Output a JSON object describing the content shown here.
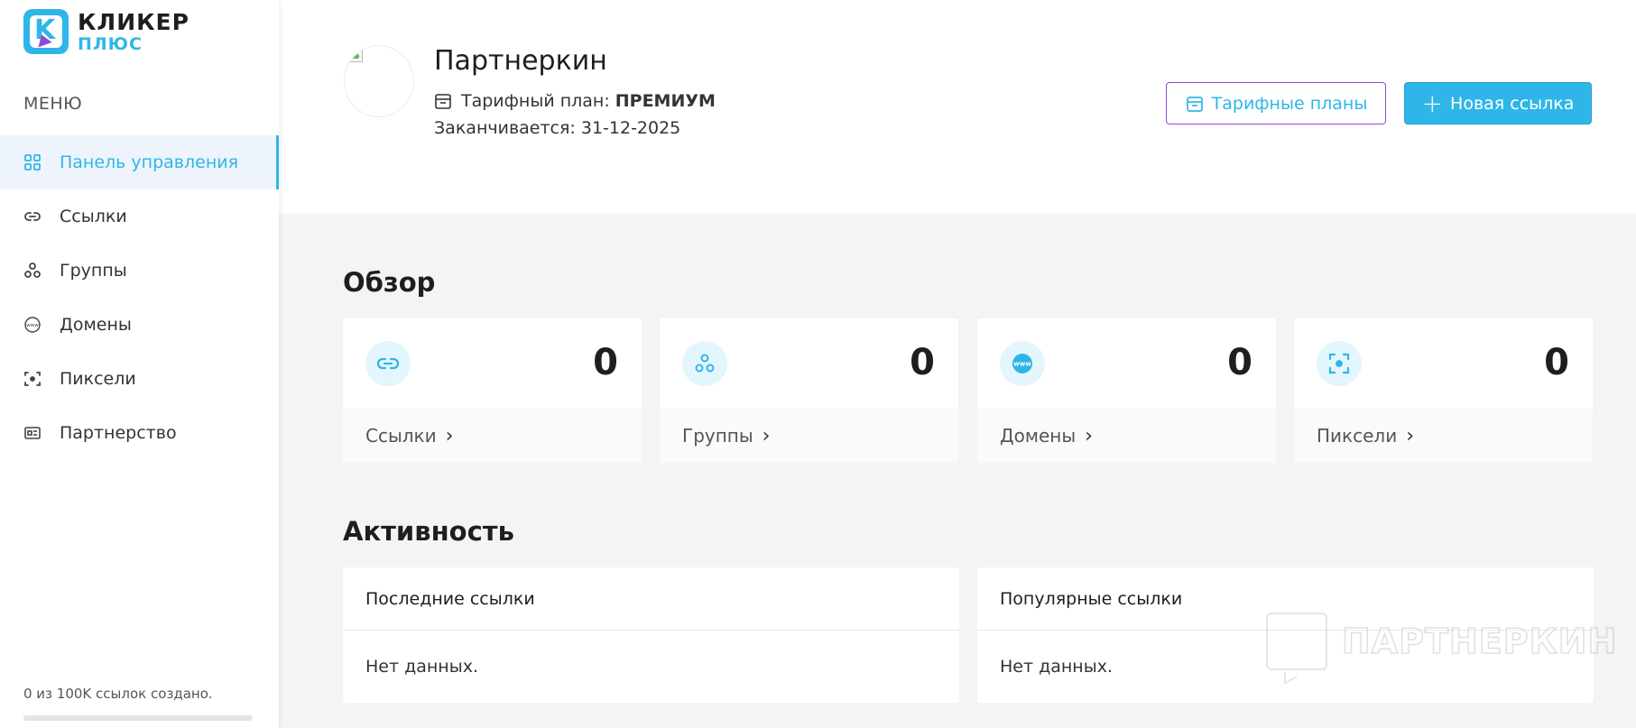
{
  "brand": {
    "name_line1": "КЛИКЕР",
    "name_line2": "ПЛЮС",
    "logo_letter": "K",
    "accent_color": "#2fb6e8",
    "secondary_color": "#8a4bd6"
  },
  "sidebar": {
    "menu_title": "МЕНЮ",
    "items": [
      {
        "label": "Панель управления",
        "icon": "dashboard-icon",
        "active": true
      },
      {
        "label": "Ссылки",
        "icon": "link-icon"
      },
      {
        "label": "Группы",
        "icon": "groups-icon"
      },
      {
        "label": "Домены",
        "icon": "domain-icon"
      },
      {
        "label": "Пиксели",
        "icon": "pixel-icon"
      },
      {
        "label": "Партнерство",
        "icon": "partnership-icon"
      }
    ],
    "usage_text": "0 из 100K ссылок создано.",
    "usage_fraction": 0
  },
  "header": {
    "username": "Партнеркин",
    "plan_label": "Тарифный план:",
    "plan_value": "ПРЕМИУМ",
    "expires": "Заканчивается: 31-12-2025",
    "plans_button": "Тарифные планы",
    "new_link_button": "Новая ссылка"
  },
  "overview": {
    "title": "Обзор",
    "cards": [
      {
        "label": "Ссылки",
        "value": "0",
        "icon": "link-icon"
      },
      {
        "label": "Группы",
        "value": "0",
        "icon": "groups-icon"
      },
      {
        "label": "Домены",
        "value": "0",
        "icon": "domain-icon"
      },
      {
        "label": "Пиксели",
        "value": "0",
        "icon": "pixel-icon"
      }
    ]
  },
  "activity": {
    "title": "Активность",
    "recent": {
      "title": "Последние ссылки",
      "empty": "Нет данных."
    },
    "popular": {
      "title": "Популярные ссылки",
      "empty": "Нет данных."
    }
  },
  "watermark": {
    "text": "ПАРТНЕРКИН"
  }
}
